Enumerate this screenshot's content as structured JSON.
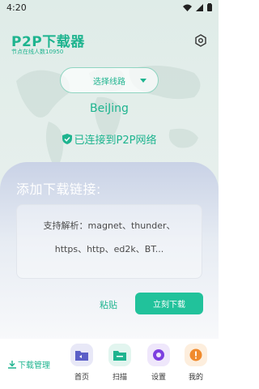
{
  "status": {
    "time": "4:20"
  },
  "app": {
    "title": "P2P下载器",
    "node_count": "节点在线人数10950"
  },
  "route": {
    "label": "选择线路"
  },
  "connection": {
    "city": "BeiJing",
    "status": "已连接到P2P网络"
  },
  "download": {
    "title": "添加下载链接:",
    "placeholder_line1": "支持解析：magnet、thunder、",
    "placeholder_line2": "https、http、ed2k、BT...",
    "paste_label": "粘贴",
    "download_label": "立刻下载"
  },
  "nav": {
    "manage_label": "下载管理",
    "tabs": [
      {
        "label": "首页",
        "icon": "folder-icon",
        "color": "#5b5fc7",
        "bg": "#e8e8f7"
      },
      {
        "label": "扫描",
        "icon": "scan-icon",
        "color": "#1eb48f",
        "bg": "#e2f5ef"
      },
      {
        "label": "设置",
        "icon": "settings-icon",
        "color": "#7d3fe0",
        "bg": "#efe7fb"
      },
      {
        "label": "我的",
        "icon": "alert-icon",
        "color": "#f08a2d",
        "bg": "#fdeedd"
      }
    ]
  },
  "colors": {
    "accent": "#1eb48f",
    "button": "#21c29b"
  }
}
